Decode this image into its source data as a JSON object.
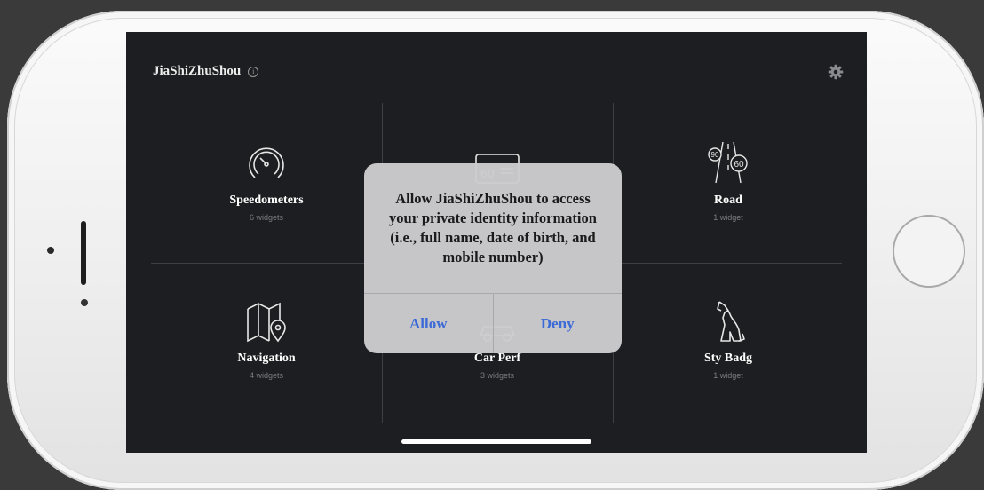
{
  "app": {
    "title": "JiaShiZhuShou"
  },
  "tiles": [
    {
      "name": "Speedometers",
      "count": "6 widgets",
      "icon": "speedometer-icon"
    },
    {
      "name": "",
      "count": "",
      "icon": "speed-limit-sign-icon",
      "icon_text": "60"
    },
    {
      "name": "Road",
      "count": "1 widget",
      "icon": "road-sign-icon",
      "icon_text_a": "90",
      "icon_text_b": "60"
    },
    {
      "name": "Navigation",
      "count": "4 widgets",
      "icon": "map-pin-icon"
    },
    {
      "name": "Car Perf",
      "count": "3 widgets",
      "icon": "car-performance-icon"
    },
    {
      "name": "Sty Badg",
      "count": "1 widget",
      "icon": "dog-icon"
    }
  ],
  "alert": {
    "message": "Allow JiaShiZhuShou to access your private identity information (i.e., full name, date of birth, and mobile number)",
    "allow_label": "Allow",
    "deny_label": "Deny"
  },
  "colors": {
    "screen_bg": "#1d1e21",
    "alert_bg": "#cdcdcf",
    "alert_button": "#3c6ad6",
    "tile_title": "#ffffff",
    "tile_subtitle": "#7b7d82"
  }
}
